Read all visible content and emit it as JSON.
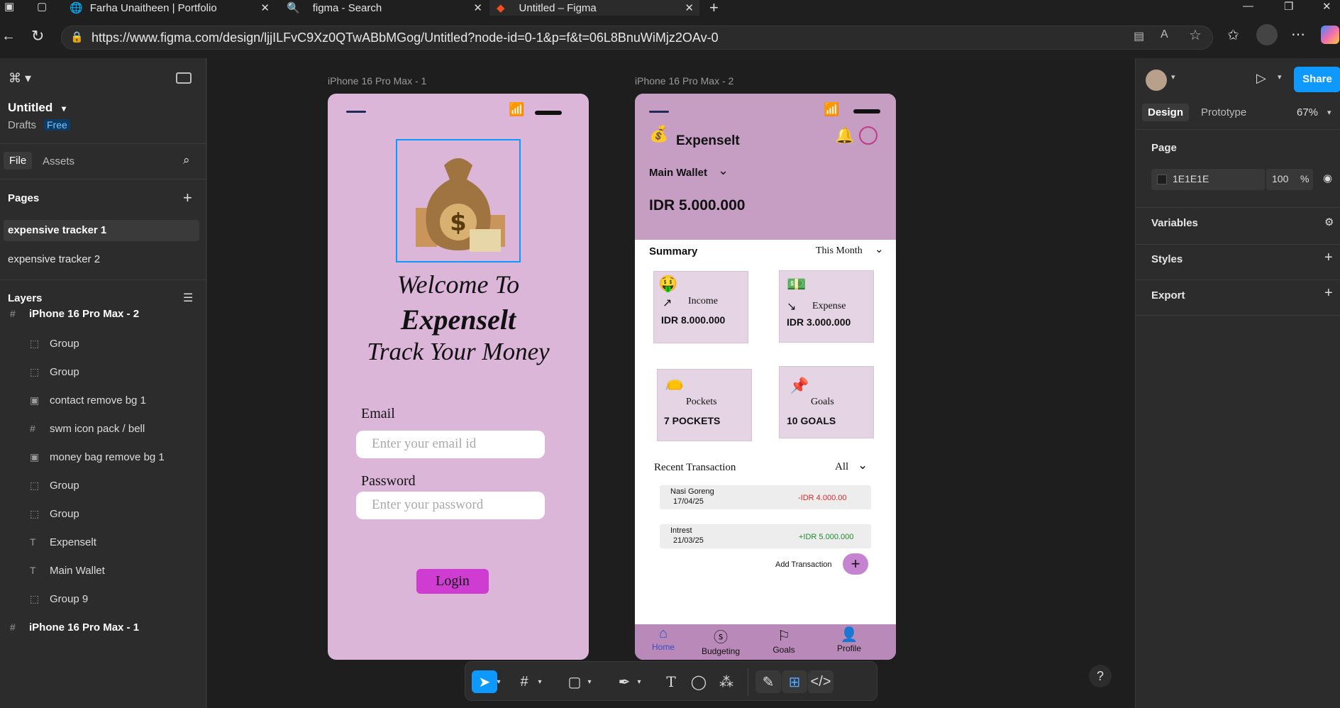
{
  "browser": {
    "tabs": [
      {
        "label": "Farha Unaitheen | Portfolio"
      },
      {
        "label": "figma - Search"
      },
      {
        "label": "Untitled – Figma"
      }
    ],
    "url": "https://www.figma.com/design/ljjILFvC9Xz0QTwABbMGog/Untitled?node-id=0-1&p=f&t=06L8BnuWiMjz2OAv-0"
  },
  "left_panel": {
    "file_name": "Untitled",
    "location": "Drafts",
    "plan_badge": "Free",
    "tab_file": "File",
    "tab_assets": "Assets",
    "pages_heading": "Pages",
    "pages": [
      "expensive tracker 1",
      "expensive tracker 2"
    ],
    "layers_heading": "Layers",
    "layers": [
      {
        "label": "iPhone 16 Pro Max - 2",
        "icon": "frame-icon",
        "depth": 0
      },
      {
        "label": "Group",
        "icon": "group-icon",
        "depth": 1
      },
      {
        "label": "Group",
        "icon": "group-icon",
        "depth": 1
      },
      {
        "label": "contact remove bg 1",
        "icon": "image-icon",
        "depth": 1
      },
      {
        "label": "swm icon pack / bell",
        "icon": "frame-icon",
        "depth": 1
      },
      {
        "label": "money bag remove bg 1",
        "icon": "image-icon",
        "depth": 1
      },
      {
        "label": "Group",
        "icon": "group-icon",
        "depth": 1
      },
      {
        "label": "Group",
        "icon": "group-icon",
        "depth": 1
      },
      {
        "label": "Expenselt",
        "icon": "text-icon",
        "depth": 1
      },
      {
        "label": "Main Wallet",
        "icon": "text-icon",
        "depth": 1
      },
      {
        "label": "Group 9",
        "icon": "group-icon",
        "depth": 1
      },
      {
        "label": "iPhone 16 Pro Max - 1",
        "icon": "frame-icon",
        "depth": 0
      }
    ]
  },
  "canvas": {
    "frame1_label": "iPhone 16 Pro Max - 1",
    "frame2_label": "iPhone 16 Pro Max - 2",
    "login": {
      "title1": "Welcome To",
      "title2": "Expenselt",
      "title3": "Track Your Money",
      "email_label": "Email",
      "email_placeholder": "Enter your email id",
      "password_label": "Password",
      "password_placeholder": "Enter your password",
      "login_button": "Login"
    },
    "home": {
      "app_name": "Expenselt",
      "wallet_label": "Main Wallet",
      "balance": "IDR 5.000.000",
      "summary_label": "Summary",
      "period": "This Month",
      "cards": [
        {
          "label": "Income",
          "value": "IDR 8.000.000"
        },
        {
          "label": "Expense",
          "value": "IDR 3.000.000"
        },
        {
          "label": "Pockets",
          "value": "7 POCKETS"
        },
        {
          "label": "Goals",
          "value": "10 GOALS"
        }
      ],
      "recent_label": "Recent Transaction",
      "filter": "All",
      "transactions": [
        {
          "name": "Nasi Goreng",
          "date": "17/04/25",
          "amount": "-IDR 4.000.00",
          "color": "#d22b2b"
        },
        {
          "name": "Intrest",
          "date": "21/03/25",
          "amount": "+IDR 5.000.000",
          "color": "#1e8b2e"
        }
      ],
      "add_transaction": "Add Transaction",
      "nav": [
        "Home",
        "Budgeting",
        "Goals",
        "Profile"
      ]
    }
  },
  "right_panel": {
    "tab_design": "Design",
    "tab_prototype": "Prototype",
    "zoom": "67%",
    "share": "Share",
    "page_heading": "Page",
    "page_color": "1E1E1E",
    "opacity": "100",
    "opacity_unit": "%",
    "variables": "Variables",
    "styles": "Styles",
    "export": "Export"
  },
  "colors": {
    "accent": "#0d99ff",
    "phone_bg": "#dbb6d9",
    "phone2_header": "#c69ec4",
    "login_button": "#cf3cd1",
    "card": "#e4d4e4",
    "navbar": "#b98ab9"
  }
}
